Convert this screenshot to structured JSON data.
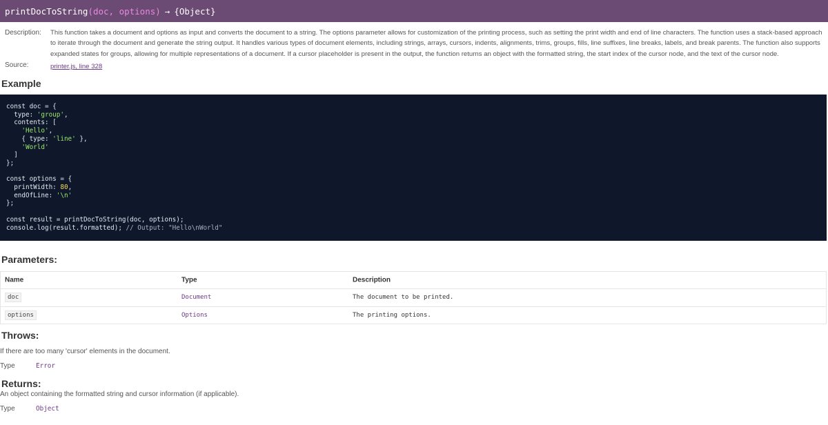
{
  "signature": {
    "name": "printDocToString",
    "params": "(doc, options)",
    "arrow": "→",
    "returns": "{Object}"
  },
  "details": {
    "description_label": "Description:",
    "description_text": "This function takes a document and options as input and converts the document to a string. The options parameter allows for customization of the printing process, such as setting the print width and end of line characters. The function uses a stack-based approach to iterate through the document and generate the string output. It handles various types of document elements, including strings, arrays, cursors, indents, alignments, trims, groups, fills, line suffixes, line breaks, labels, and break parents. The function also supports expanded states for groups, allowing for multiple representations of a document. If a cursor placeholder is present in the output, the function returns an object with the formatted string, the start index of the cursor node, and the text of the cursor node.",
    "source_label": "Source:",
    "source_link": "printer.js, line 328"
  },
  "example": {
    "title": "Example"
  },
  "parameters": {
    "title": "Parameters:",
    "headers": {
      "name": "Name",
      "type": "Type",
      "description": "Description"
    },
    "rows": [
      {
        "name": "doc",
        "type": "Document",
        "description": "The document to be printed."
      },
      {
        "name": "options",
        "type": "Options",
        "description": "The printing options."
      }
    ]
  },
  "throws": {
    "title": "Throws:",
    "text": "If there are too many 'cursor' elements in the document.",
    "type_label": "Type",
    "type_value": "Error"
  },
  "returns": {
    "title": "Returns:",
    "text": "An object containing the formatted string and cursor information (if applicable).",
    "type_label": "Type",
    "type_value": "Object"
  }
}
